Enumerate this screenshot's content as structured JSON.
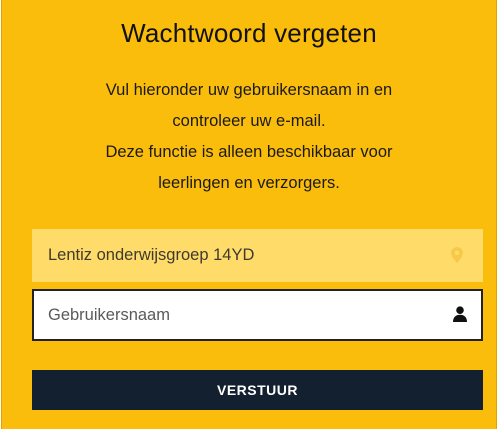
{
  "form": {
    "title": "Wachtwoord vergeten",
    "description_lines": [
      "Vul hieronder uw gebruikersnaam in en",
      "controleer uw e-mail.",
      "Deze functie is alleen beschikbaar voor",
      "leerlingen en verzorgers."
    ],
    "school_field": {
      "value": "Lentiz onderwijsgroep 14YD",
      "icon": "map-marker-icon"
    },
    "username_field": {
      "placeholder": "Gebruikersnaam",
      "value": "",
      "icon": "user-icon"
    },
    "submit_label": "VERSTUUR"
  },
  "colors": {
    "panel_background": "#fbbd0b",
    "school_field_background": "#ffdc6a",
    "button_background": "#132030",
    "button_text": "#ffffff"
  }
}
